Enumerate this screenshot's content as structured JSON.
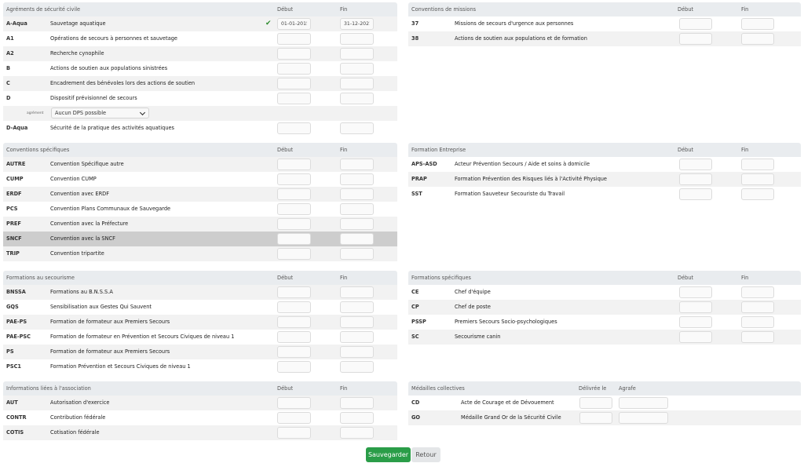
{
  "left": [
    {
      "title": "Agréments de sécurité civile",
      "col1": "Début",
      "col2": "Fin",
      "rows": [
        {
          "code": "A-Aqua",
          "label": "Sauvetage aquatique",
          "checked": true,
          "start": "01-01-2015",
          "end": "31-12-2021"
        },
        {
          "code": "A1",
          "label": "Opérations de secours à personnes et sauvetage"
        },
        {
          "code": "A2",
          "label": "Recherche cynophile"
        },
        {
          "code": "B",
          "label": "Actions de soutien aux populations sinistrées"
        },
        {
          "code": "C",
          "label": "Encadrement des bénévoles lors des actions de soutien"
        },
        {
          "code": "D",
          "label": "Dispositif prévisionnel de secours"
        },
        {
          "type": "select",
          "small_label": "agrément",
          "value": "Aucun DPS possible"
        },
        {
          "code": "D-Aqua",
          "label": "Sécurité de la pratique des activités aquatiques"
        }
      ]
    },
    {
      "title": "Conventions spécifiques",
      "col1": "Début",
      "col2": "Fin",
      "rows": [
        {
          "code": "AUTRE",
          "label": "Convention Spécifique autre"
        },
        {
          "code": "CUMP",
          "label": "Convention CUMP"
        },
        {
          "code": "ERDF",
          "label": "Convention avec ERDF"
        },
        {
          "code": "PCS",
          "label": "Convention Plans Communaux de Sauvegarde"
        },
        {
          "code": "PREF",
          "label": "Convention avec la Préfecture"
        },
        {
          "code": "SNCF",
          "label": "Convention avec la SNCF",
          "highlight": true
        },
        {
          "code": "TRIP",
          "label": "Convention tripartite"
        }
      ]
    },
    {
      "title": "Formations au secourisme",
      "col1": "Début",
      "col2": "Fin",
      "rows": [
        {
          "code": "BNSSA",
          "label": "Formations au B.N.S.S.A"
        },
        {
          "code": "GQS",
          "label": "Sensibilisation aux Gestes Qui Sauvent"
        },
        {
          "code": "PAE-PS",
          "label": "Formation de formateur aux Premiers Secours"
        },
        {
          "code": "PAE-PSC",
          "label": "Formation de formateur en Prévention et Secours Civiques de niveau 1"
        },
        {
          "code": "PS",
          "label": "Formation de formateur aux Premiers Secours"
        },
        {
          "code": "PSC1",
          "label": "Formation Prévention et Secours Civiques de niveau 1"
        }
      ]
    },
    {
      "title": "Informations liées à l'association",
      "col1": "Début",
      "col2": "Fin",
      "rows": [
        {
          "code": "AUT",
          "label": "Autorisation d'exercice"
        },
        {
          "code": "CONTR",
          "label": "Contribution fédérale"
        },
        {
          "code": "COTIS",
          "label": "Cotisation fédérale"
        }
      ]
    }
  ],
  "right": [
    {
      "title": "Conventions de missions",
      "col1": "Début",
      "col2": "Fin",
      "rows": [
        {
          "code": "37",
          "label": "Missions de secours d'urgence aux personnes"
        },
        {
          "code": "38",
          "label": "Actions de soutien aux populations et de formation"
        }
      ]
    },
    {
      "title": "Formation Entreprise",
      "col1": "Début",
      "col2": "Fin",
      "rows": [
        {
          "code": "APS-ASD",
          "label": "Acteur Prévention Secours / Aide et soins à domicile"
        },
        {
          "code": "PRAP",
          "label": "Formation Prévention des Risques liés à l'Activité Physique"
        },
        {
          "code": "SST",
          "label": "Formation Sauveteur Secouriste du Travail"
        }
      ]
    },
    {
      "title": "Formations spécifiques",
      "col1": "Début",
      "col2": "Fin",
      "rows": [
        {
          "code": "CE",
          "label": "Chef d'équipe"
        },
        {
          "code": "CP",
          "label": "Chef de poste"
        },
        {
          "code": "PSSP",
          "label": "Premiers Secours Socio-psychologiques"
        },
        {
          "code": "SC",
          "label": "Secourisme canin"
        }
      ]
    },
    {
      "title": "Médailles collectives",
      "col1": "Délivrée le",
      "col2": "Agrafe",
      "rows": [
        {
          "code": "CD",
          "label": "Acte de Courage et de Dévouement"
        },
        {
          "code": "GO",
          "label": "Médaille Grand Or de la Sécurité Civile"
        }
      ]
    }
  ],
  "buttons": {
    "save": "Sauvegarder",
    "back": "Retour"
  },
  "colors": {
    "header_bg": "#e9ecef",
    "row_alt": "#f2f2f2",
    "row_highlight": "#cdcdcd",
    "save_bg": "#2a9d48",
    "check": "#2e8b2e"
  }
}
